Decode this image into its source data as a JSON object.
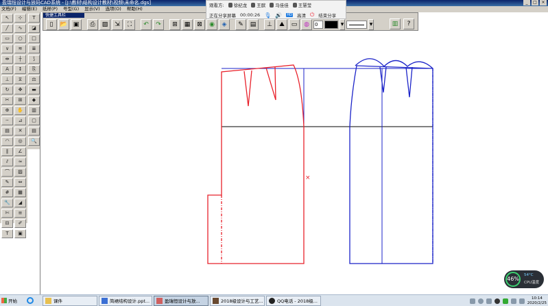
{
  "window": {
    "title": "盈瑞恒设计与放码CAD系统 - [J:\\教材\\结构设计教材\\视频\\未命名.dgs]"
  },
  "menu": [
    "文档(F)",
    "编辑(E)",
    "纸样(P)",
    "号型(G)",
    "显示(V)",
    "选项(O)",
    "帮助(H)"
  ],
  "quick_toolbar": {
    "title": "快捷工具栏",
    "line_width_value": "0"
  },
  "share_bar": {
    "viewers_label": "观看方:",
    "viewers": [
      "徐纪龙",
      "王膑",
      "马佳佳",
      "王慧莹"
    ],
    "status": "正在分享屏幕",
    "timer": "00:00:26",
    "hd_badge": "HD",
    "hd_label": "高清",
    "stop_label": "结束分享"
  },
  "taskbar": {
    "start_label": "开始",
    "tasks": [
      {
        "label": "课件",
        "active": false
      },
      {
        "label": "简裙结构设计.ppt...",
        "active": false
      },
      {
        "label": "盈瑞恒设计与放...",
        "active": true
      },
      {
        "label": "2018级设计与工艺...",
        "active": false
      },
      {
        "label": "QQ电话 - 2018级...",
        "active": false
      }
    ],
    "clock_time": "10:14",
    "clock_date": "2020/2/25"
  },
  "cpu_widget": {
    "percent": "46%",
    "temp": "54°C",
    "label": "CPU温度"
  },
  "colors": {
    "front_pattern": "#e8202a",
    "back_pattern": "#1a22c8",
    "guide_line": "#000000",
    "title_bar": "#0a246a",
    "panel": "#d4d0c8"
  },
  "icons": {
    "left_tools": [
      "select-arrow-icon",
      "point-select-icon",
      "line-tool-icon",
      "curve-tool-icon",
      "rect-tool-icon",
      "circle-tool-icon",
      "dart-tool-icon",
      "pleat-tool-icon",
      "measure-icon",
      "ruler-icon",
      "text-tool-icon",
      "grain-line-icon",
      "notch-tool-icon",
      "mirror-icon",
      "rotate-icon",
      "move-icon",
      "cut-icon",
      "merge-icon",
      "zoom-icon",
      "pan-icon",
      "seam-icon",
      "grade-icon",
      "label-icon",
      "delete-icon"
    ]
  }
}
